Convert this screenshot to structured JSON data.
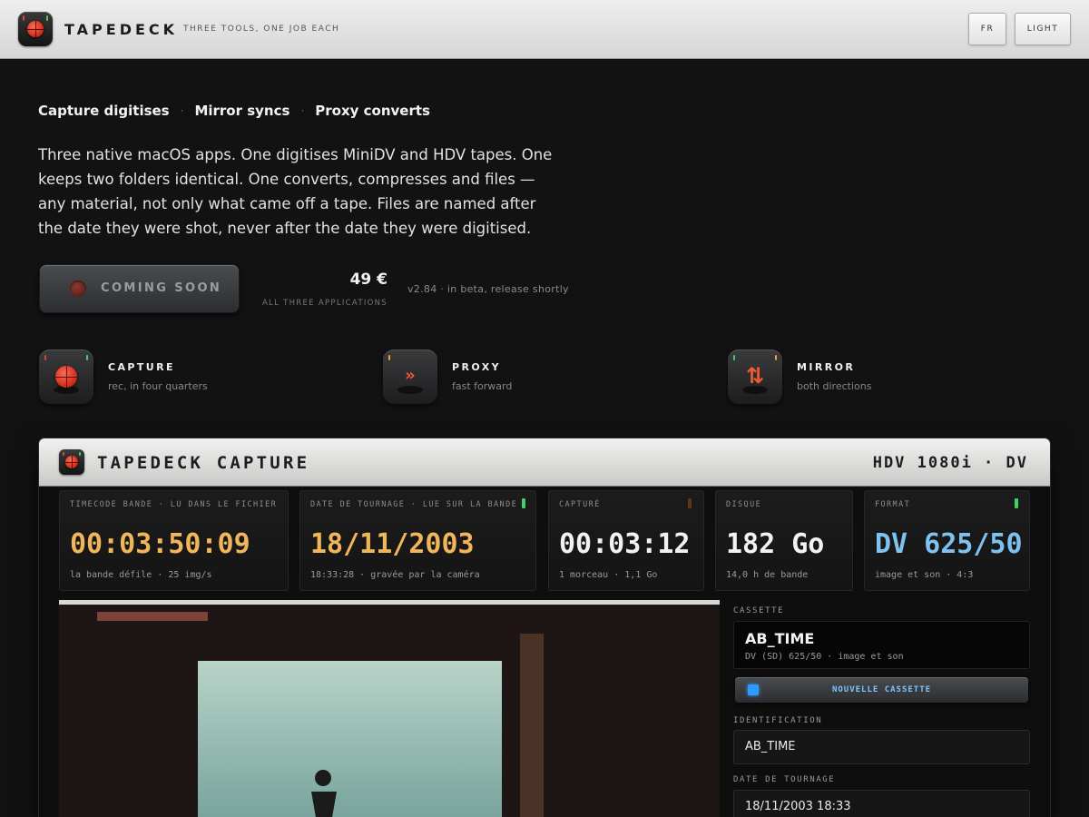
{
  "header": {
    "brand": "TAPEDECK",
    "tagline": "THREE TOOLS, ONE JOB EACH",
    "language_button": "FR",
    "theme_button": "LIGHT"
  },
  "hero": {
    "nav": [
      "Capture digitises",
      "Mirror syncs",
      "Proxy converts"
    ],
    "intro": "Three native macOS apps. One digitises MiniDV and HDV tapes. One keeps two folders identical. One converts, compresses and files — any material, not only what came off a tape. Files are named after the date they were shot, never after the date they were digitised.",
    "cta_label": "COMING SOON",
    "price": "49 €",
    "price_note": "ALL THREE APPLICATIONS",
    "version": "v2.84 · in beta, release shortly"
  },
  "apps": [
    {
      "name": "CAPTURE",
      "desc": "rec, in four quarters",
      "icon": "record-reticle-icon"
    },
    {
      "name": "PROXY",
      "desc": "fast forward",
      "icon": "fast-forward-icon"
    },
    {
      "name": "MIRROR",
      "desc": "both directions",
      "icon": "two-way-arrows-icon"
    }
  ],
  "capture_window": {
    "title": "TAPEDECK CAPTURE",
    "format": "HDV 1080i · DV",
    "panels": [
      {
        "label": "TIMECODE BANDE · LU DANS LE FICHIER",
        "value": "00:03:50:09",
        "sub": "la bande défile · 25 img/s",
        "color": "#f2b65a"
      },
      {
        "label": "DATE DE TOURNAGE · LUE SUR LA BANDE",
        "value": "18/11/2003",
        "sub": "18:33:28 · gravée par la caméra",
        "color": "#f2b65a"
      },
      {
        "label": "CAPTURÉ",
        "value": "00:03:12",
        "sub": "1 morceau · 1,1 Go",
        "color": "#f2f2f2"
      },
      {
        "label": "DISQUE",
        "value": "182 Go",
        "sub": "14,0 h de bande",
        "color": "#f2f2f2"
      },
      {
        "label": "FORMAT",
        "value": "DV 625/50",
        "sub": "image et son · 4:3",
        "color": "#7ec3ef"
      }
    ],
    "sidebar": {
      "cassette_label": "CASSETTE",
      "cassette_name": "AB_TIME",
      "cassette_meta": "DV (SD) 625/50 · image et son",
      "new_cassette_button": "NOUVELLE CASSETTE",
      "identification_label": "IDENTIFICATION",
      "identification_value": "AB_TIME",
      "shoot_date_label": "DATE DE TOURNAGE",
      "shoot_date_value": "18/11/2003 18:33"
    }
  }
}
